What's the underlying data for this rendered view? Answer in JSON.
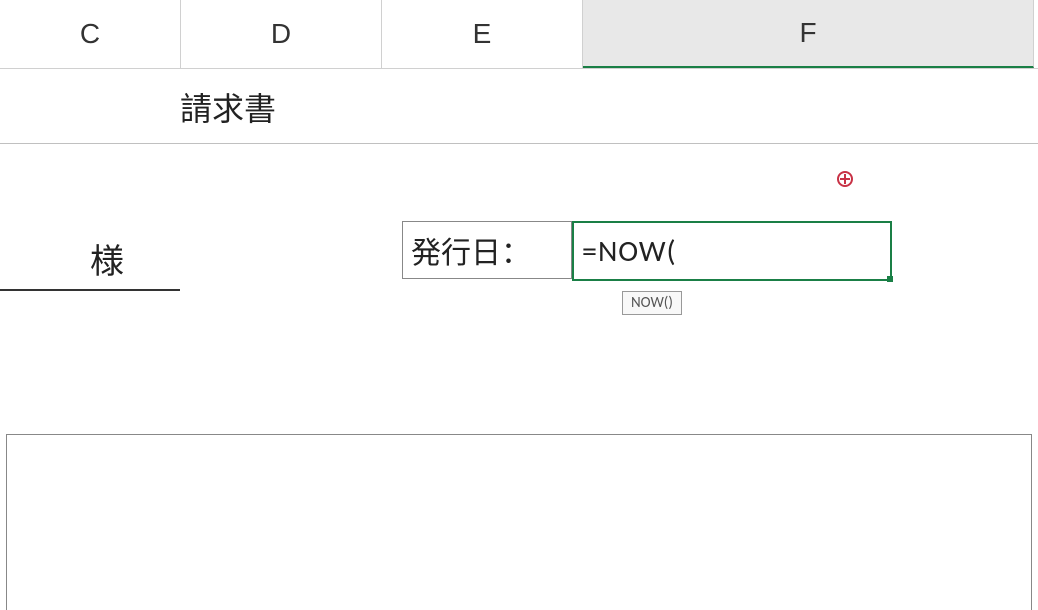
{
  "columns": {
    "c": "C",
    "d": "D",
    "e": "E",
    "f": "F"
  },
  "content": {
    "title": "請求書",
    "recipient_suffix": "様",
    "issue_date_label": "発行日：",
    "formula_input": "=NOW(",
    "tooltip": "NOW()"
  }
}
